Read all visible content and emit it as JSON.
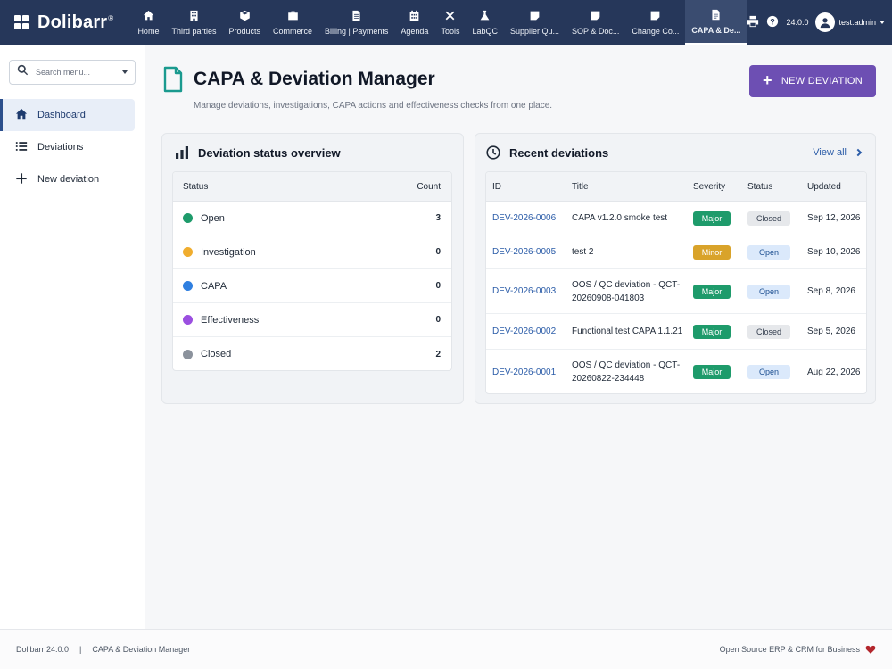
{
  "brand": {
    "name": "Dolibarr",
    "reg": "®"
  },
  "nav": [
    {
      "label": "Home",
      "icon": "home-icon"
    },
    {
      "label": "Third parties",
      "icon": "building-icon"
    },
    {
      "label": "Products",
      "icon": "box-icon"
    },
    {
      "label": "Commerce",
      "icon": "briefcase-icon"
    },
    {
      "label": "Billing | Payments",
      "icon": "invoice-icon"
    },
    {
      "label": "Agenda",
      "icon": "calendar-icon"
    },
    {
      "label": "Tools",
      "icon": "tools-icon"
    },
    {
      "label": "LabQC",
      "icon": "flask-icon"
    },
    {
      "label": "Supplier Qu...",
      "icon": "note-icon"
    },
    {
      "label": "SOP & Doc...",
      "icon": "note-icon"
    },
    {
      "label": "Change Co...",
      "icon": "note-icon"
    },
    {
      "label": "CAPA & De...",
      "icon": "document-icon",
      "active": true
    }
  ],
  "topbar": {
    "version": "24.0.0",
    "user": "test.admin"
  },
  "sidebar": {
    "search_placeholder": "Search menu...",
    "items": [
      {
        "label": "Dashboard",
        "icon": "home-icon",
        "active": true
      },
      {
        "label": "Deviations",
        "icon": "list-icon"
      },
      {
        "label": "New deviation",
        "icon": "plus-icon"
      }
    ]
  },
  "header": {
    "title": "CAPA & Deviation Manager",
    "subtitle": "Manage deviations, investigations, CAPA actions and effectiveness checks from one place.",
    "new_button": "NEW DEVIATION"
  },
  "status_card": {
    "title": "Deviation status overview",
    "col_status": "Status",
    "col_count": "Count",
    "rows": [
      {
        "label": "Open",
        "count": "3",
        "color": "#1e9b6b"
      },
      {
        "label": "Investigation",
        "count": "0",
        "color": "#f0ad2e"
      },
      {
        "label": "CAPA",
        "count": "0",
        "color": "#2f7fe0"
      },
      {
        "label": "Effectiveness",
        "count": "0",
        "color": "#9b4fe0"
      },
      {
        "label": "Closed",
        "count": "2",
        "color": "#8b929c"
      }
    ]
  },
  "recent_card": {
    "title": "Recent deviations",
    "view_all": "View all",
    "columns": {
      "id": "ID",
      "title": "Title",
      "severity": "Severity",
      "status": "Status",
      "updated": "Updated"
    },
    "rows": [
      {
        "id": "DEV-2026-0006",
        "title": "CAPA v1.2.0 smoke test",
        "severity": "Major",
        "status": "Closed",
        "updated": "Sep 12, 2026"
      },
      {
        "id": "DEV-2026-0005",
        "title": "test 2",
        "severity": "Minor",
        "status": "Open",
        "updated": "Sep 10, 2026"
      },
      {
        "id": "DEV-2026-0003",
        "title": "OOS / QC deviation - QCT-20260908-041803",
        "severity": "Major",
        "status": "Open",
        "updated": "Sep 8, 2026"
      },
      {
        "id": "DEV-2026-0002",
        "title": "Functional test CAPA 1.1.21",
        "severity": "Major",
        "status": "Closed",
        "updated": "Sep 5, 2026"
      },
      {
        "id": "DEV-2026-0001",
        "title": "OOS / QC deviation - QCT-20260822-234448",
        "severity": "Major",
        "status": "Open",
        "updated": "Aug 22, 2026"
      }
    ]
  },
  "footer": {
    "version": "Dolibarr 24.0.0",
    "sep": "|",
    "module": "CAPA & Deviation Manager",
    "tagline": "Open Source ERP & CRM for Business"
  },
  "colors": {
    "topbar": "#26375a",
    "accent": "#6d4fb3",
    "link": "#2b5ca8",
    "major": "#1e9b6b",
    "minor": "#d9a32a"
  }
}
